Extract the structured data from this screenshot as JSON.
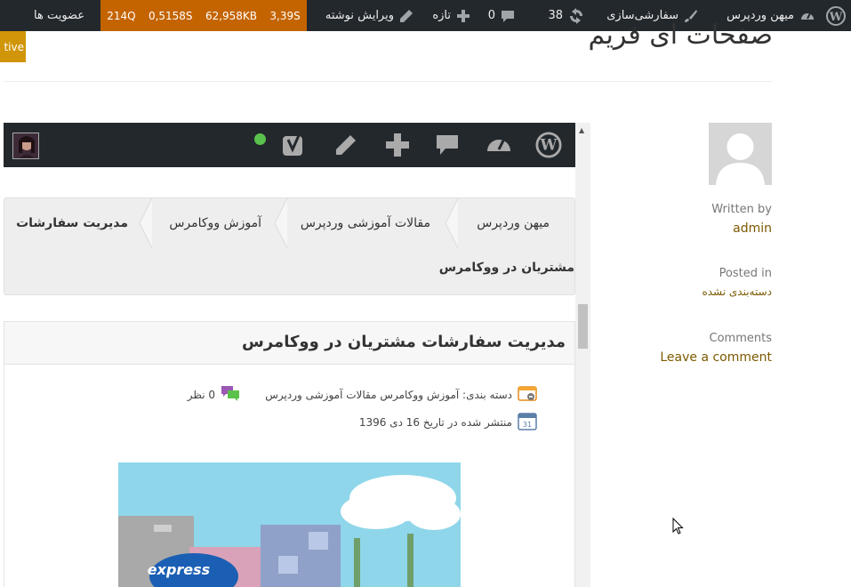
{
  "admin_bar": {
    "site_name": "میهن وردپرس",
    "customize": "سفارشی‌سازی",
    "updates_count": "38",
    "comments_count": "0",
    "new_label": "تازه",
    "edit_post": "ویرایش نوشته",
    "query_monitor": {
      "queries": "214Q",
      "query_time": "0,5158S",
      "memory": "62,958KB",
      "load_time": "3,39S"
    },
    "membership": "عضویت ها"
  },
  "active_badge": "tive",
  "page": {
    "title": "صفحات ای فریم"
  },
  "meta": {
    "written_by_label": "Written by",
    "author": "admin",
    "posted_in_label": "Posted in",
    "category": "دسته‌بندی نشده",
    "comments_label": "Comments",
    "leave_comment": "Leave a comment"
  },
  "embedded": {
    "breadcrumb": [
      "میهن وردپرس",
      "مقالات آموزشی وردپرس",
      "آموزش ووکامرس",
      "مدیریت سفارشات"
    ],
    "breadcrumb_tail": "مشتریان در ووکامرس",
    "post_title": "مدیریت سفارشات مشتریان در ووکامرس",
    "category_line": "دسته بندی: آموزش ووکامرس مقالات آموزشی وردپرس",
    "comments_line": "0 نظر",
    "date_line": "منتشر شده در تاریخ 16 دی 1396",
    "calendar_day": "31",
    "hero_brand": "express"
  },
  "colors": {
    "admin_bar": "#23282d",
    "query_monitor": "#c46400",
    "active_badge": "#d09508",
    "link": "#7c5a00"
  }
}
